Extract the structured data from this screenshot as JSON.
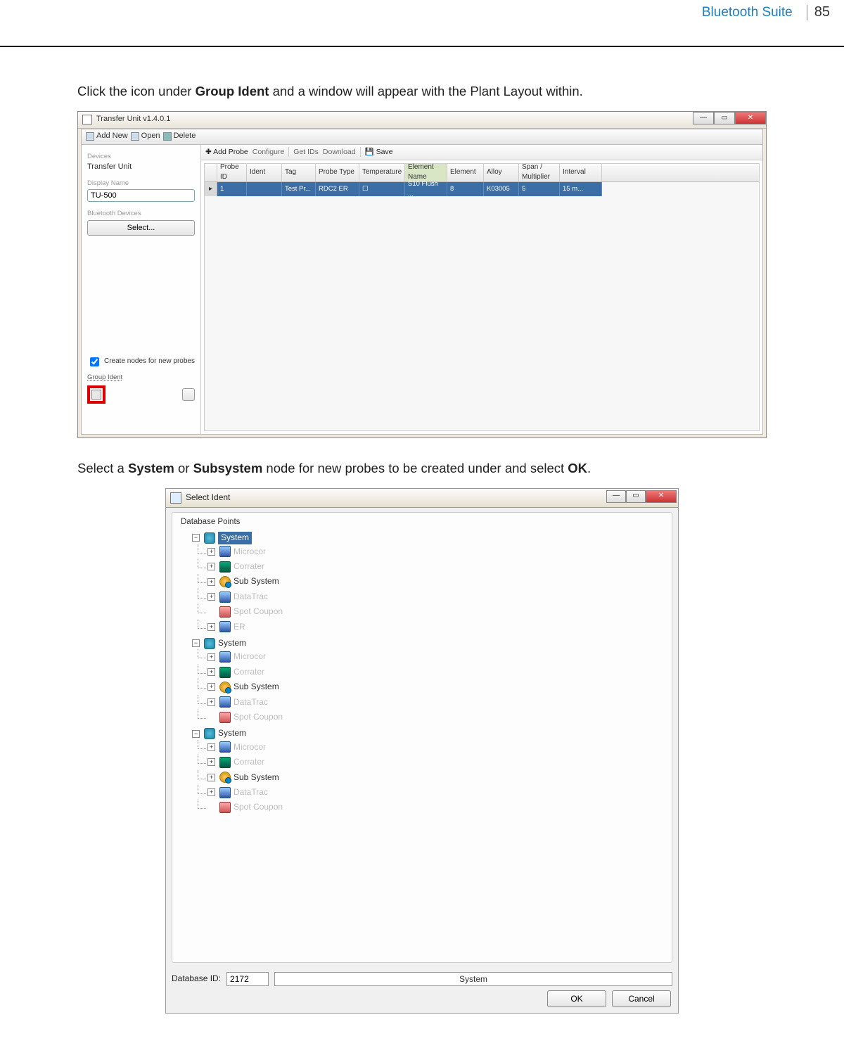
{
  "header": {
    "title": "Bluetooth Suite",
    "page": "85"
  },
  "instr1_a": "Click the icon under ",
  "instr1_b": "Group Ident",
  "instr1_c": " and a window will appear with the Plant Layout within.",
  "instr2_a": "Select a ",
  "instr2_b": "System",
  "instr2_c": " or ",
  "instr2_d": "Subsystem",
  "instr2_e": " node for new probes to be created under and select ",
  "instr2_f": "OK",
  "instr2_g": ".",
  "shot1": {
    "title": "Transfer Unit v1.4.0.1",
    "toolbar1": {
      "addnew": "Add New",
      "open": "Open",
      "delete": "Delete"
    },
    "left": {
      "devices_lbl": "Devices",
      "device": "Transfer Unit",
      "display_name_lbl": "Display Name",
      "display_name": "TU-500",
      "bt_lbl": "Bluetooth Devices",
      "select": "Select...",
      "create_nodes": "Create nodes for new probes",
      "group_ident": "Group Ident"
    },
    "toolbar2": {
      "add": "Add Probe",
      "conf": "Configure",
      "getids": "Get IDs",
      "download": "Download",
      "save": "Save"
    },
    "cols": {
      "probeid": "Probe ID",
      "ident": "Ident",
      "tag": "Tag",
      "ptype": "Probe Type",
      "temp": "Temperature",
      "ename": "Element Name",
      "elem": "Element",
      "alloy": "Alloy",
      "span": "Span / Multiplier",
      "interval": "Interval"
    },
    "row": {
      "probeid": "1",
      "ident": "",
      "tag": "Test Pr...",
      "ptype": "RDC2 ER",
      "temp_chk": "☐",
      "ename": "S10 Flush ...",
      "elem": "8",
      "alloy": "K03005",
      "span": "5",
      "interval": "15 m..."
    }
  },
  "shot2": {
    "title": "Select Ident",
    "group": "Database Points",
    "tree": [
      {
        "label": "System",
        "selected": true,
        "children": [
          {
            "icon": "microcor",
            "label": "Microcor"
          },
          {
            "icon": "corrater",
            "label": "Corrater"
          },
          {
            "icon": "sub",
            "label": "Sub System",
            "on": true
          },
          {
            "icon": "data",
            "label": "DataTrac"
          },
          {
            "icon": "span",
            "label": "Spot Coupon",
            "leaf": true
          },
          {
            "icon": "er",
            "label": "ER"
          }
        ]
      },
      {
        "label": "System",
        "children": [
          {
            "icon": "microcor",
            "label": "Microcor"
          },
          {
            "icon": "corrater",
            "label": "Corrater"
          },
          {
            "icon": "sub",
            "label": "Sub System",
            "on": true
          },
          {
            "icon": "data",
            "label": "DataTrac"
          },
          {
            "icon": "span",
            "label": "Spot Coupon",
            "leaf": true
          }
        ]
      },
      {
        "label": "System",
        "children": [
          {
            "icon": "microcor",
            "label": "Microcor"
          },
          {
            "icon": "corrater",
            "label": "Corrater"
          },
          {
            "icon": "sub",
            "label": "Sub System",
            "on": true
          },
          {
            "icon": "data",
            "label": "DataTrac"
          },
          {
            "icon": "span",
            "label": "Spot Coupon",
            "leaf": true
          }
        ]
      }
    ],
    "db_id_lbl": "Database ID:",
    "db_id": "2172",
    "path": "System",
    "ok": "OK",
    "cancel": "Cancel"
  }
}
